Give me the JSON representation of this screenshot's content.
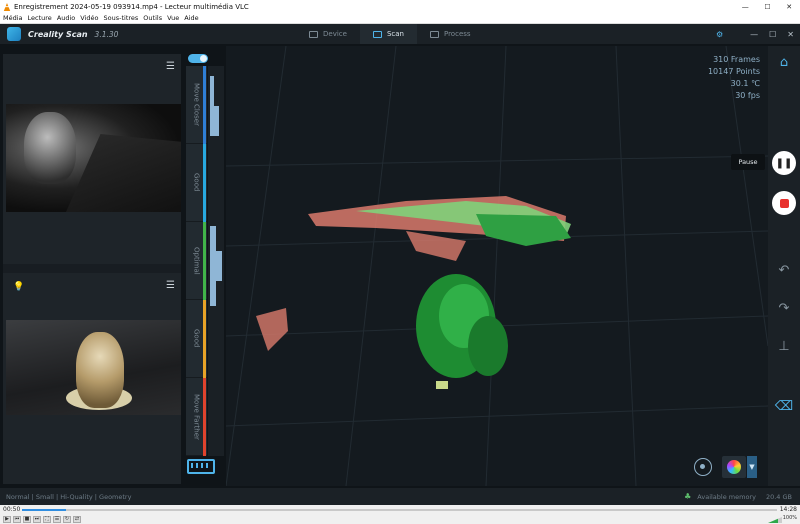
{
  "window": {
    "title": "Enregistrement 2024-05-19 093914.mp4 - Lecteur multimédia VLC",
    "controls": [
      "—",
      "☐",
      "✕"
    ]
  },
  "vlc_menu": [
    "Média",
    "Lecture",
    "Audio",
    "Vidéo",
    "Sous-titres",
    "Outils",
    "Vue",
    "Aide"
  ],
  "app": {
    "name": "Creality Scan",
    "version": "3.1.30",
    "tabs": [
      {
        "label": "Device",
        "active": false
      },
      {
        "label": "Scan",
        "active": true
      },
      {
        "label": "Process",
        "active": false
      }
    ],
    "header_controls": [
      "⚙",
      "—",
      "☐",
      "✕"
    ]
  },
  "distance_zones": [
    {
      "label": "Move Closer",
      "color": "#2f7fd6"
    },
    {
      "label": "Good",
      "color": "#28a9e0"
    },
    {
      "label": "Optimal",
      "color": "#41b54a"
    },
    {
      "label": "Good",
      "color": "#e8a327"
    },
    {
      "label": "Move Farther",
      "color": "#e0432d"
    }
  ],
  "stats": {
    "frames": "310 Frames",
    "points": "10147 Points",
    "temp": "30.1 ℃",
    "fps": "30 fps"
  },
  "tools": {
    "pause_tooltip": "Pause"
  },
  "status": {
    "modes": "Normal | Small | Hi-Quality | Geometry",
    "memory_label": "Available memory",
    "memory_value": "20.4 GB"
  },
  "player": {
    "elapsed": "00:50",
    "total": "14:28",
    "progress": 0.058,
    "volume": "100%"
  }
}
